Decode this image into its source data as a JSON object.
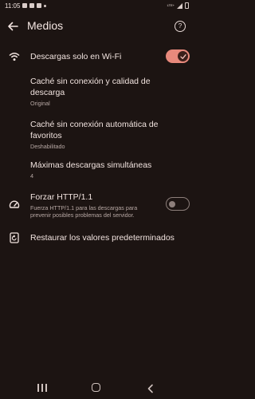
{
  "status_bar": {
    "time": "11:05",
    "lte": "LTE+"
  },
  "header": {
    "title": "Medios",
    "help_label": "?"
  },
  "settings": {
    "wifi_only": {
      "title": "Descargas solo en Wi-Fi",
      "on": true
    },
    "offline_cache_quality": {
      "title": "Caché sin conexión y calidad de descarga",
      "value": "Original"
    },
    "auto_offline_favorites": {
      "title": "Caché sin conexión automática de favoritos",
      "value": "Deshabilitado"
    },
    "max_downloads": {
      "title": "Máximas descargas simultáneas",
      "value": "4"
    },
    "force_http": {
      "title": "Forzar HTTP/1.1",
      "description": "Fuerza HTTP/1.1 para las descargas para prevenir posibles problemas del servidor.",
      "on": false
    },
    "restore_defaults": {
      "title": "Restaurar los valores predeterminados"
    }
  },
  "icons": [
    "back-arrow-icon",
    "help-icon",
    "wifi-icon",
    "speedometer-icon",
    "restore-icon",
    "check-icon"
  ],
  "colors": {
    "background": "#1c1412",
    "accent": "#e8897c",
    "text": "#f1e3df",
    "secondary_text": "#b7a8a4"
  }
}
